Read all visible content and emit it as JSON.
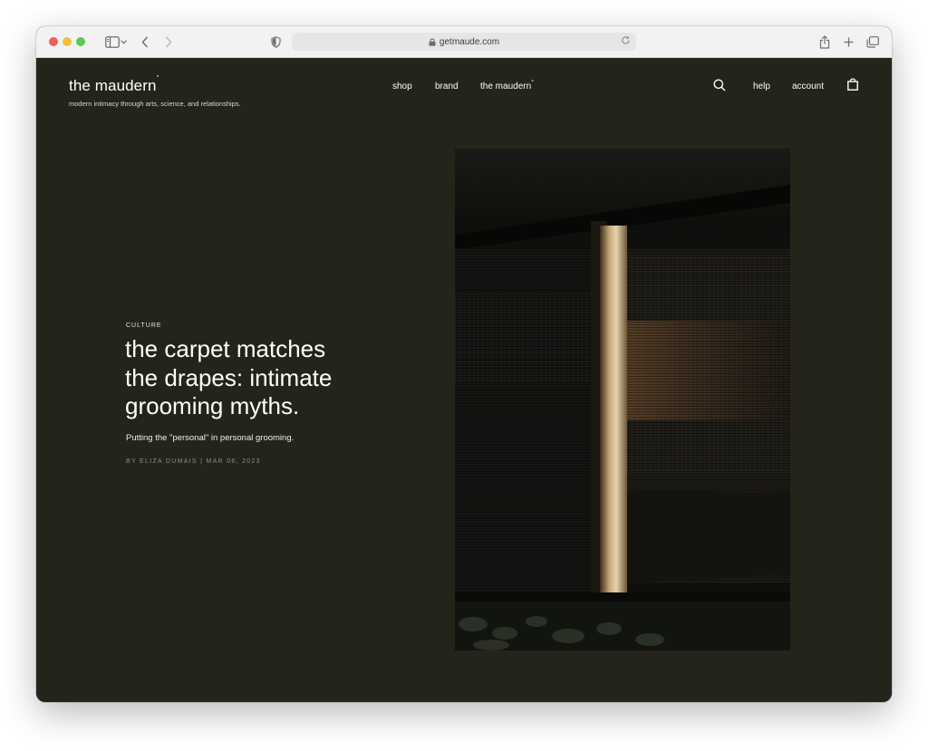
{
  "browser": {
    "url": "getmaude.com"
  },
  "site": {
    "brand": "the maudern",
    "brand_mark": "°",
    "tagline": "modern intimacy through arts, science, and relationships."
  },
  "nav": {
    "shop": "shop",
    "brand": "brand",
    "maudern": "the maudern",
    "maudern_mark": "°",
    "help": "help",
    "account": "account"
  },
  "article": {
    "category": "CULTURE",
    "title": "the carpet matches the drapes: intimate grooming myths.",
    "subtitle": "Putting the \"personal\" in personal grooming.",
    "byline": "BY ELIZA DUMAIS | MAR 06, 2023"
  },
  "icons": {
    "sidebar": "sidebar-icon",
    "back": "chevron-left-icon",
    "forward": "chevron-right-icon",
    "privacy": "shield-icon",
    "lock": "lock-icon",
    "reload": "reload-icon",
    "share": "share-icon",
    "new_tab": "plus-icon",
    "tabs": "tabs-icon",
    "search": "search-icon",
    "bag": "shopping-bag-icon"
  },
  "colors": {
    "page_background": "#24241a",
    "text": "#ffffff",
    "byline": "#8d8d80"
  }
}
